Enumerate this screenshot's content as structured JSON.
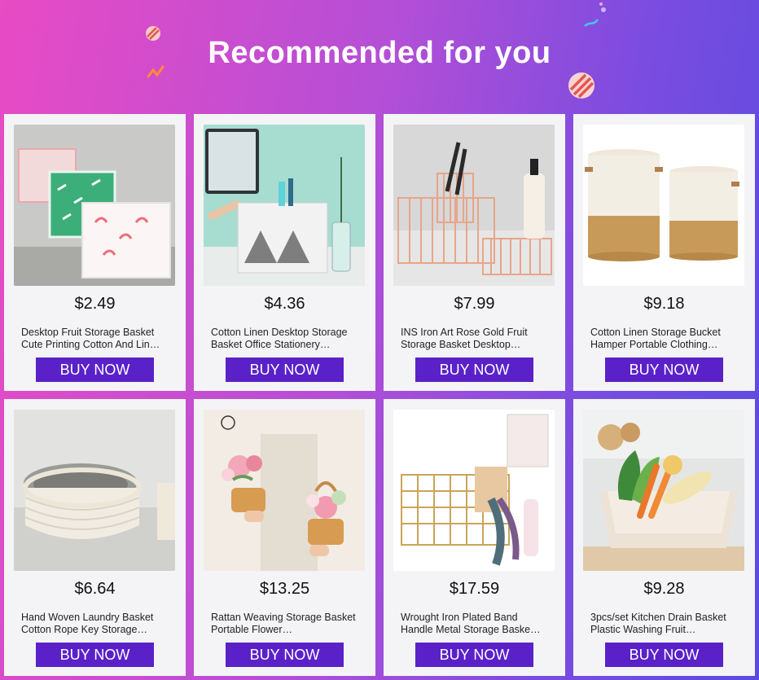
{
  "header": {
    "title": "Recommended for you"
  },
  "colors": {
    "button": "#5a21c9",
    "card": "#f4f4f6"
  },
  "products": [
    {
      "price": "$2.49",
      "name": "Desktop Fruit Storage Basket Cute Printing Cotton And Lin…",
      "button": "BUY NOW",
      "image": "fabric-storage-boxes-image"
    },
    {
      "price": "$4.36",
      "name": "Cotton Linen Desktop Storage Basket Office Stationery…",
      "button": "BUY NOW",
      "image": "linen-desk-basket-image"
    },
    {
      "price": "$7.99",
      "name": "INS Iron Art Rose Gold Fruit Storage Basket Desktop…",
      "button": "BUY NOW",
      "image": "rose-gold-wire-basket-image"
    },
    {
      "price": "$9.18",
      "name": "Cotton Linen Storage Bucket Hamper Portable Clothing…",
      "button": "BUY NOW",
      "image": "linen-hamper-image"
    },
    {
      "price": "$6.64",
      "name": "Hand Woven Laundry Basket Cotton Rope Key Storage…",
      "button": "BUY NOW",
      "image": "cotton-rope-basket-image"
    },
    {
      "price": "$13.25",
      "name": "Rattan Weaving Storage Basket Portable Flower…",
      "button": "BUY NOW",
      "image": "rattan-flower-basket-image"
    },
    {
      "price": "$17.59",
      "name": "Wrought Iron Plated Band Handle Metal Storage Baske…",
      "button": "BUY NOW",
      "image": "gold-metal-basket-image"
    },
    {
      "price": "$9.28",
      "name": "3pcs/set Kitchen Drain Basket Plastic Washing Fruit…",
      "button": "BUY NOW",
      "image": "kitchen-drain-basket-image"
    }
  ]
}
